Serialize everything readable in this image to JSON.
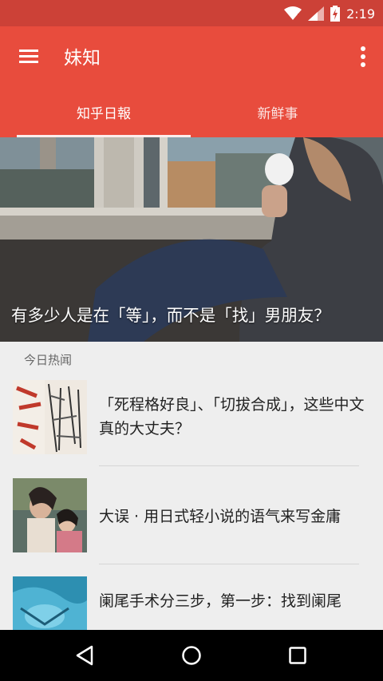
{
  "statusbar": {
    "time": "2:19"
  },
  "appbar": {
    "title": "妹知",
    "icons": [
      "menu-icon",
      "overflow-icon"
    ]
  },
  "tabs": [
    {
      "label": "知乎日報",
      "selected": true
    },
    {
      "label": "新鲜事",
      "selected": false
    }
  ],
  "hero": {
    "title": "有多少人是在「等」，而不是「找」男朋友？"
  },
  "section": {
    "label": "今日热闻"
  },
  "news": [
    {
      "title": "「死程格好良」、「切拔合成」，这些中文真的大丈夫？"
    },
    {
      "title": "大误 · 用日式轻小说的语气来写金庸"
    },
    {
      "title": "阑尾手术分三步，第一步：找到阑尾"
    }
  ],
  "colors": {
    "primary": "#e84c3d",
    "primary_dark": "#cc4137"
  }
}
